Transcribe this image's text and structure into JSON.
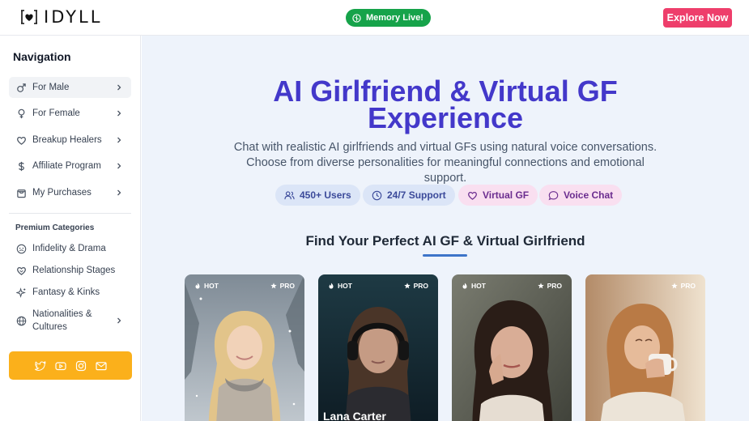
{
  "header": {
    "logo_text": "IDYLL",
    "live_label": "Memory Live!",
    "explore_label": "Explore Now"
  },
  "sidebar": {
    "title": "Navigation",
    "items": [
      {
        "label": "For Male",
        "icon": "male-icon"
      },
      {
        "label": "For Female",
        "icon": "female-icon"
      },
      {
        "label": "Breakup Healers",
        "icon": "heart-icon"
      },
      {
        "label": "Affiliate Program",
        "icon": "dollar-icon"
      },
      {
        "label": "My Purchases",
        "icon": "shopping-bag-icon"
      }
    ],
    "premium_title": "Premium Categories",
    "categories": [
      {
        "label": "Infidelity & Drama",
        "icon": "drama-icon"
      },
      {
        "label": "Relationship Stages",
        "icon": "hearts-icon"
      },
      {
        "label": "Fantasy & Kinks",
        "icon": "sparkles-icon"
      },
      {
        "label": "Nationalities &",
        "label2": "Cultures",
        "icon": "globe-icon"
      }
    ],
    "social_icons": [
      "twitter-icon",
      "youtube-icon",
      "instagram-icon",
      "mail-icon"
    ]
  },
  "hero": {
    "title_line1": "AI Girlfriend & Virtual GF",
    "title_line2": "Experience",
    "subtitle_line1": "Chat with realistic AI girlfriends and virtual GFs using natural voice conversations. Choose",
    "subtitle_line2": "from diverse personalities for meaningful connections and emotional support.",
    "pills": [
      {
        "label": "450+ Users",
        "icon": "users-icon"
      },
      {
        "label": "24/7 Support",
        "icon": "clock-icon"
      },
      {
        "label": "Virtual GF",
        "icon": "heart-icon"
      },
      {
        "label": "Voice Chat",
        "icon": "chat-bubble-icon"
      }
    ]
  },
  "section": {
    "title": "Find Your Perfect AI GF & Virtual Girlfriend"
  },
  "cards": [
    {
      "hot": "HOT",
      "pro": "PRO",
      "name": ""
    },
    {
      "hot": "HOT",
      "pro": "PRO",
      "name": "Lana Carter"
    },
    {
      "hot": "HOT",
      "pro": "PRO",
      "name": ""
    },
    {
      "hot": "",
      "pro": "PRO",
      "name": ""
    }
  ],
  "colors": {
    "brand_indigo": "#4338ca",
    "live_green": "#16a34a",
    "explore_pink": "#ee3e6b",
    "social_yellow": "#fbb01b",
    "main_bg": "#eef3fb"
  }
}
